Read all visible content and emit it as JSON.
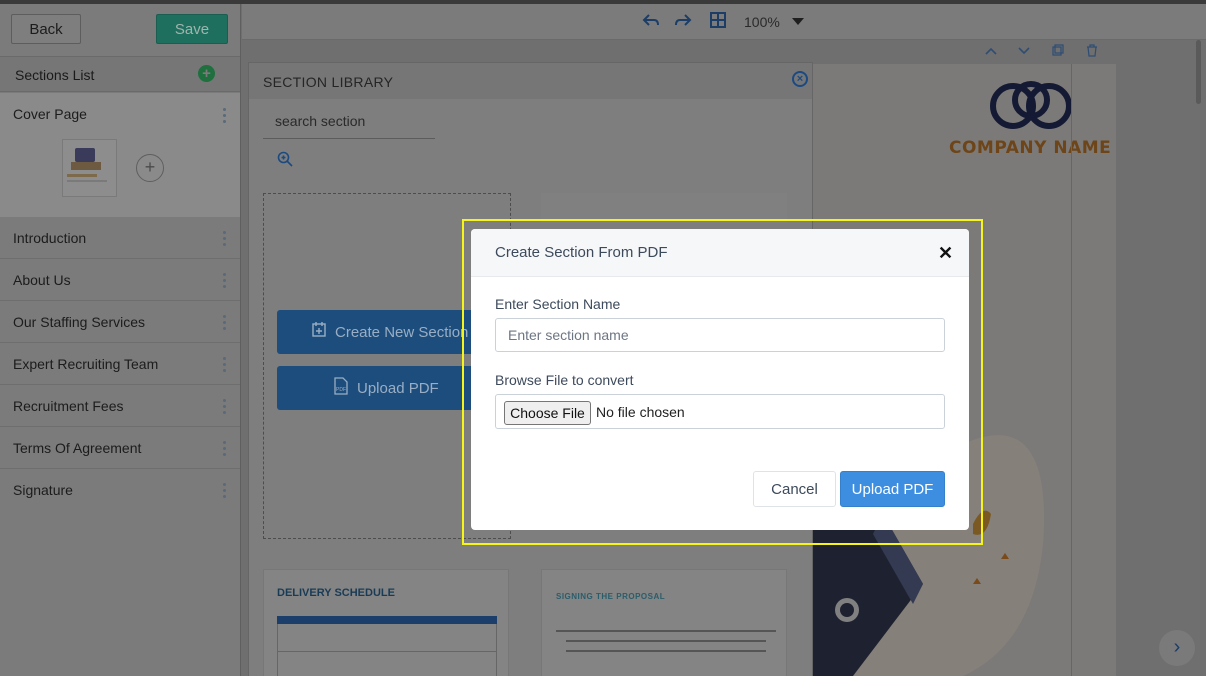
{
  "sidebar": {
    "back_label": "Back",
    "save_label": "Save",
    "sections_title": "Sections List",
    "items": [
      {
        "label": "Cover Page"
      },
      {
        "label": "Introduction"
      },
      {
        "label": "About Us"
      },
      {
        "label": "Our Staffing Services"
      },
      {
        "label": "Expert Recruiting Team"
      },
      {
        "label": "Recruitment Fees"
      },
      {
        "label": "Terms Of Agreement"
      },
      {
        "label": "Signature"
      }
    ]
  },
  "toolbar": {
    "undo_icon": "undo-icon",
    "redo_icon": "redo-icon",
    "grid_icon": "grid-icon",
    "zoom": "100%"
  },
  "page_preview": {
    "company_name": "COMPANY NAME"
  },
  "library": {
    "title": "SECTION LIBRARY",
    "search_placeholder": "search section",
    "create_label": "Create New Section",
    "upload_label": "Upload PDF",
    "card1_title": "DELIVERY SCHEDULE",
    "card2_title": "SIGNING THE PROPOSAL"
  },
  "modal": {
    "title": "Create Section From PDF",
    "name_label": "Enter Section Name",
    "name_placeholder": "Enter section name",
    "file_label": "Browse File to convert",
    "choose_label": "Choose File",
    "no_file_text": "No file chosen",
    "cancel_label": "Cancel",
    "upload_label": "Upload PDF"
  },
  "colors": {
    "highlight": "#f5f51a",
    "primary": "#3d8ee0",
    "save": "#1f6f5e"
  }
}
